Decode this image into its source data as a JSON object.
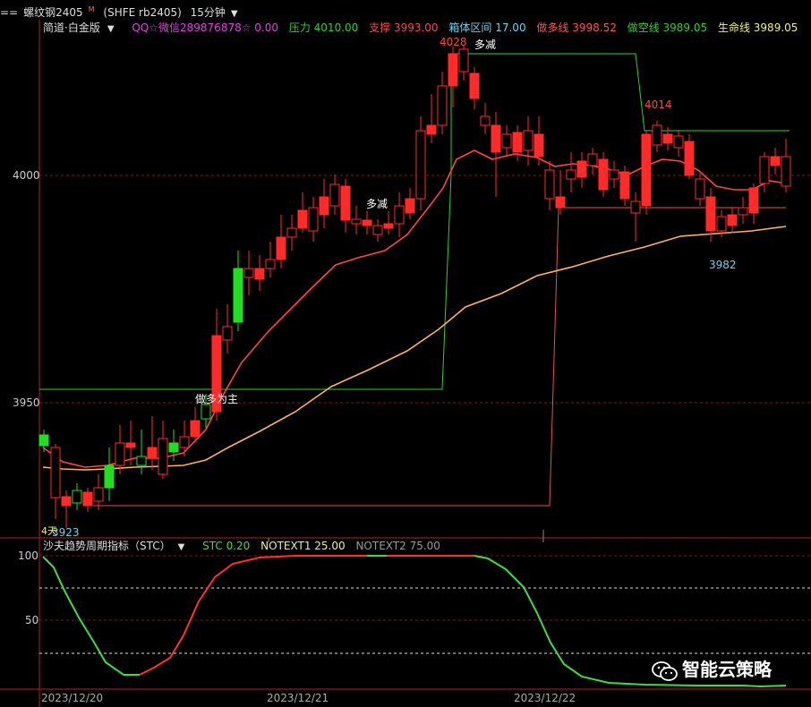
{
  "header": {
    "prefix": "==",
    "symbol_name": "螺纹钢2405",
    "symbol_sup": "M",
    "symbol_code": "(SHFE rb2405)",
    "period": "15分钟"
  },
  "info_bar": {
    "strategy": "简道·白金版",
    "qq": "QQ☆微信289876878☆ 0.00",
    "pressure": "压力 4010.00",
    "support": "支撑 3993.00",
    "box": "箱体区间 17.00",
    "long_line": "做多线 3998.52",
    "short_line": "做空线 3989.05",
    "life_line": "生命线 3989.05"
  },
  "colors": {
    "up": "#ff2a2a",
    "down": "#22dd22",
    "ma_fast": "#ff4444",
    "ma_slow": "#ffb060",
    "pressure": "#2fcf2f",
    "support": "#e05050",
    "box": "#6ad0f0",
    "qq": "#e040e0",
    "life": "#f0f080"
  },
  "price_axis": {
    "labels": [
      "4000",
      "3950"
    ]
  },
  "annotations": {
    "high_price": "4028",
    "high_signal": "多减",
    "mid_signal": "多减",
    "peak2": "4014",
    "low2": "3982",
    "long_main": "做多为主",
    "low_price": "3923",
    "days": "4天"
  },
  "stc": {
    "title": "沙夫趋势周期指标（STC）",
    "stc_value": "STC 0.20",
    "notext1": "NOTEXT1 25.00",
    "notext2": "NOTEXT2 75.00",
    "axis_labels": [
      "100",
      "50"
    ]
  },
  "dates": [
    "2023/12/20",
    "2023/12/21",
    "2023/12/22"
  ],
  "watermark": {
    "text": "智能云策略",
    "icon": "wechat-icon"
  }
}
